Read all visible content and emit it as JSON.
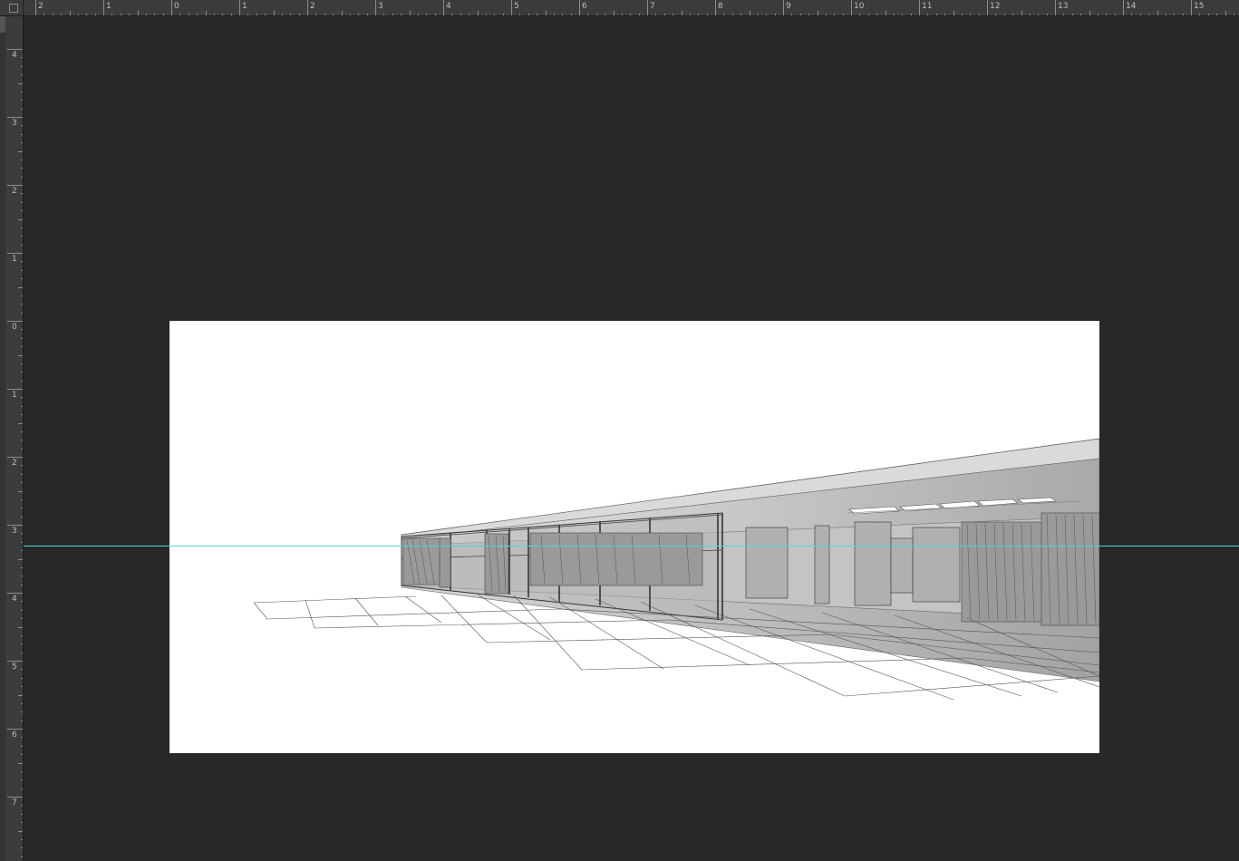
{
  "rulers": {
    "horizontal_labels": [
      "2",
      "1",
      "0",
      "1",
      "2",
      "3",
      "4",
      "5",
      "6",
      "7",
      "8",
      "9",
      "10",
      "11",
      "12",
      "13",
      "14",
      "15"
    ],
    "vertical_labels": [
      "4",
      "3",
      "2",
      "1",
      "0",
      "1",
      "2",
      "3",
      "4",
      "5",
      "6",
      "7"
    ]
  },
  "canvas": {
    "background": "#ffffff"
  },
  "guide": {
    "color": "#4fd6d6"
  },
  "colors": {
    "workspace": "#282828",
    "ruler": "#3c3c3c"
  }
}
